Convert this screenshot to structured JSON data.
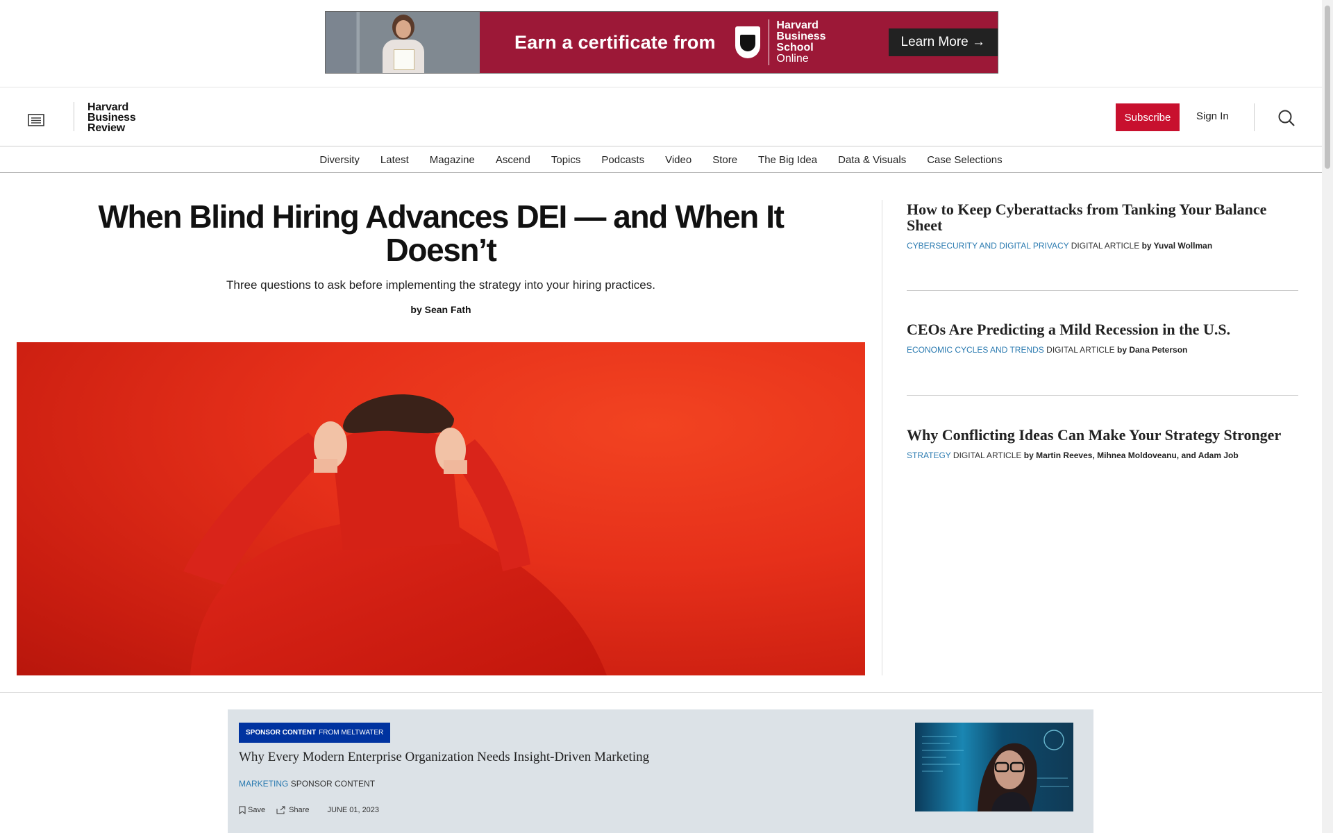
{
  "ad": {
    "headline": "Earn a certificate from",
    "brand_line1": "Harvard",
    "brand_line2": "Business",
    "brand_line3": "School",
    "brand_line4": "Online",
    "cta": "Learn More →",
    "color": "#9c1837"
  },
  "header": {
    "logo_line1": "Harvard",
    "logo_line2": "Business",
    "logo_line3": "Review",
    "subscribe_label": "Subscribe",
    "signin_label": "Sign In",
    "accent": "#c8102e"
  },
  "nav": [
    "Diversity",
    "Latest",
    "Magazine",
    "Ascend",
    "Topics",
    "Podcasts",
    "Video",
    "Store",
    "The Big Idea",
    "Data & Visuals",
    "Case Selections"
  ],
  "article": {
    "title": "When Blind Hiring Advances DEI — and When It Doesn’t",
    "dek": "Three questions to ask before implementing the strategy into your hiring practices.",
    "byline": "by Sean Fath"
  },
  "sidebar": [
    {
      "title": "How to Keep Cyberattacks from Tanking Your Balance Sheet",
      "topic": "Cybersecurity and Digital Privacy",
      "kind": "Digital Article",
      "by": "by Yuval Wollman"
    },
    {
      "title": "CEOs Are Predicting a Mild Recession in the U.S.",
      "topic": "Economic Cycles and Trends",
      "kind": "Digital Article",
      "by": "by Dana Peterson"
    },
    {
      "title": "Why Conflicting Ideas Can Make Your Strategy Stronger",
      "topic": "Strategy",
      "kind": "Digital Article",
      "by": "by Martin Reeves, Mihnea Moldoveanu, and Adam Job"
    }
  ],
  "sponsor": {
    "badge_bold": "SPONSOR CONTENT",
    "badge_rest": "FROM MELTWATER",
    "title": "Why Every Modern Enterprise Organization Needs Insight-Driven Marketing",
    "topic": "MARKETING",
    "kind": "SPONSOR CONTENT",
    "save_label": "Save",
    "share_label": "Share",
    "date": "JUNE 01, 2023"
  },
  "colors": {
    "topic_link": "#2a7ab0",
    "sponsor_badge": "#0033a0"
  }
}
